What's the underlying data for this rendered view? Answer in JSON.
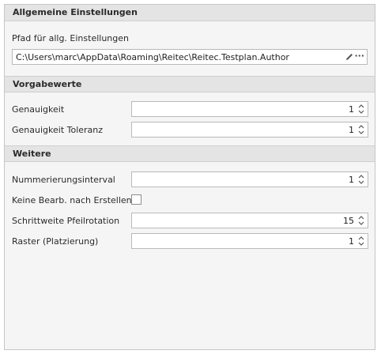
{
  "sections": {
    "general": {
      "title": "Allgemeine Einstellungen",
      "path_label": "Pfad für allg. Einstellungen",
      "path_value": "C:\\Users\\marc\\AppData\\Roaming\\Reitec\\Reitec.Testplan.Author",
      "ellipsis": "···"
    },
    "defaults": {
      "title": "Vorgabewerte",
      "genauigkeit_label": "Genauigkeit",
      "genauigkeit_value": "1",
      "toleranz_label": "Genauigkeit Toleranz",
      "toleranz_value": "1"
    },
    "more": {
      "title": "Weitere",
      "nummer_label": "Nummerierungsinterval",
      "nummer_value": "1",
      "keine_label": "Keine Bearb. nach Erstellen",
      "pfeil_label": "Schrittweite Pfeilrotation",
      "pfeil_value": "15",
      "raster_label": "Raster (Platzierung)",
      "raster_value": "1"
    }
  },
  "icons": {
    "edit": "pencil-icon",
    "browse": "ellipsis-icon",
    "spin_up": "chevron-up-icon",
    "spin_down": "chevron-down-icon"
  }
}
